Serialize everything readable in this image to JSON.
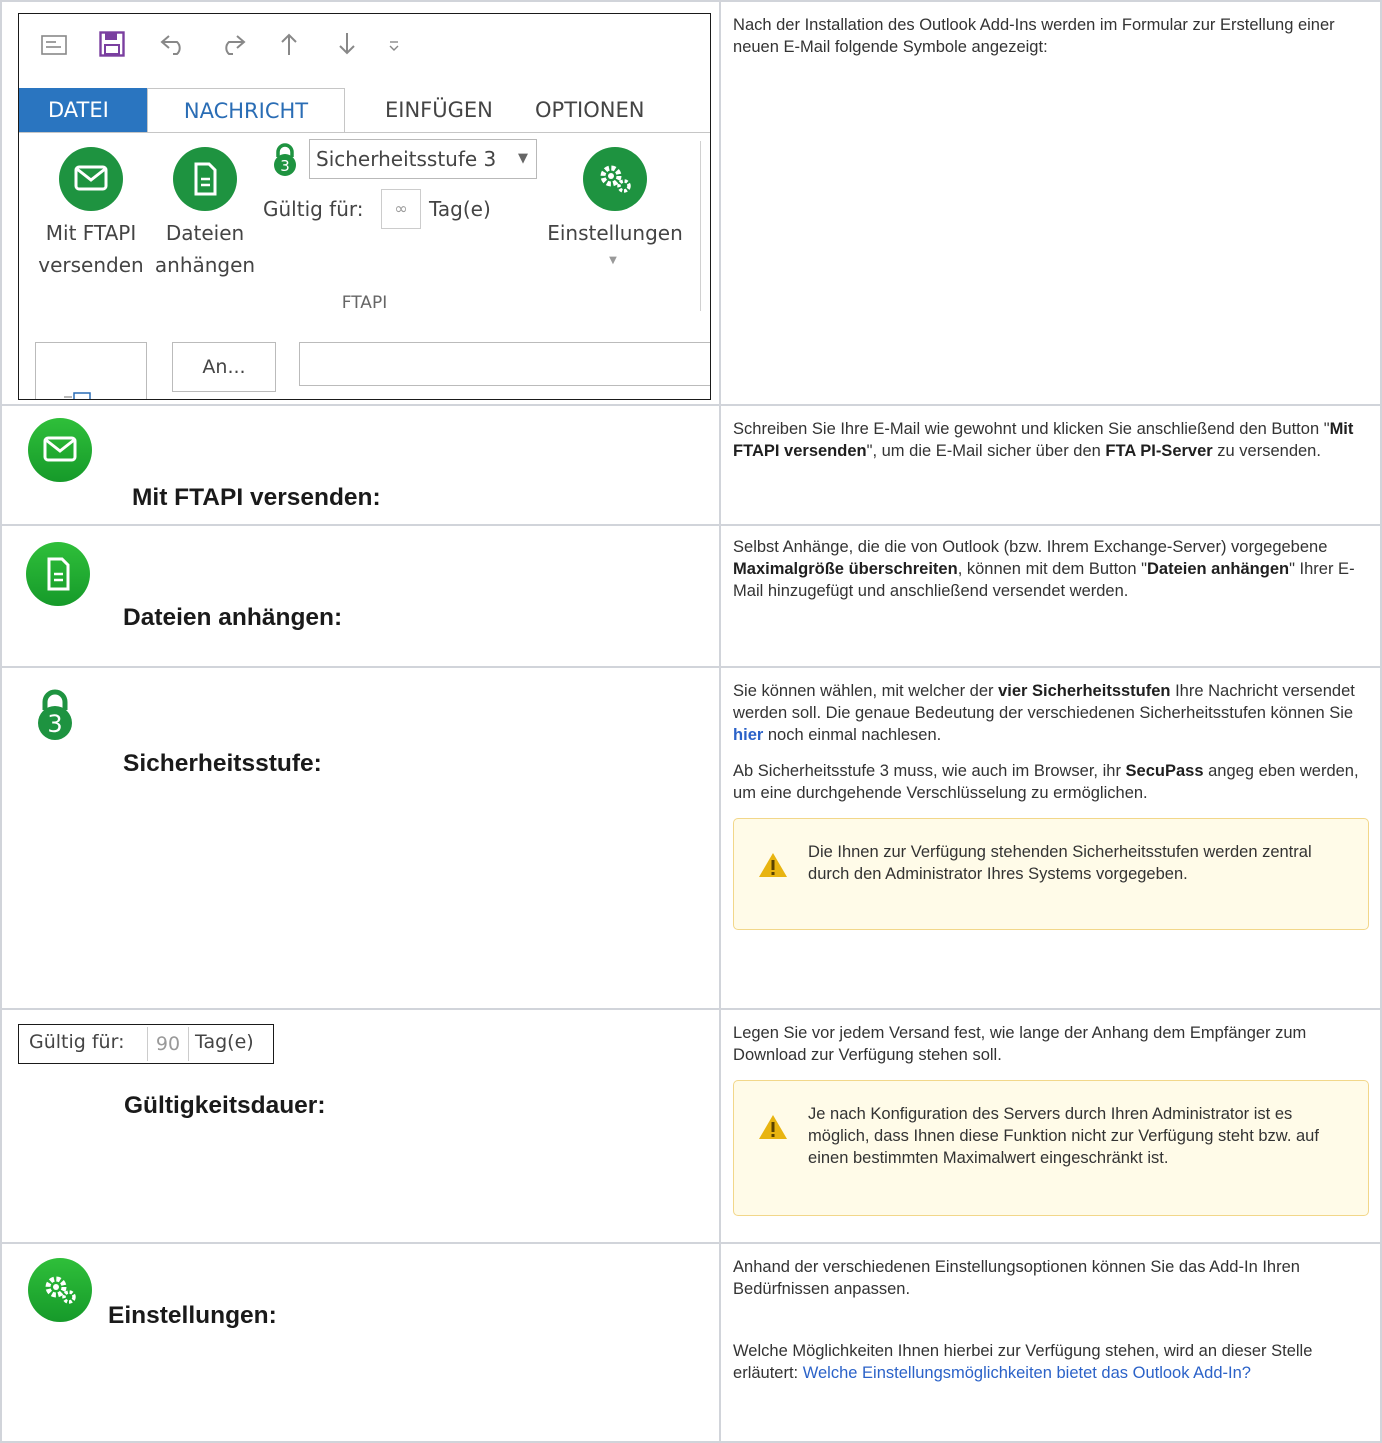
{
  "intro": {
    "text": "Nach der Installation des Outlook Add-Ins werden im Formular zur Erstellung einer neuen E-Mail folgende Symbole angezeigt:"
  },
  "ribbon": {
    "tabs": [
      "DATEI",
      "NACHRICHT",
      "EINFÜGEN",
      "OPTIONEN"
    ],
    "buttons": {
      "send_line1": "Mit FTAPI",
      "send_line2": "versenden",
      "attach_line1": "Dateien",
      "attach_line2": "anhängen",
      "settings": "Einstellungen"
    },
    "security_select": "Sicherheitsstufe 3",
    "security_badge": "3",
    "valid_label": "Gültig für:",
    "valid_value": "∞",
    "valid_unit": "Tag(e)",
    "group_label": "FTAPI",
    "to_button": "An..."
  },
  "rows": {
    "send": {
      "caption": "Mit FTAPI versenden:",
      "t1": "Schreiben Sie Ihre E-Mail wie gewohnt und klicken Sie anschließend den Button \"",
      "b1": "Mit FTAPI versenden",
      "t2": "\", um die E-Mail sicher über den ",
      "b2": "FTA PI-Server",
      "t3": " zu versenden."
    },
    "attach": {
      "caption": "Dateien anhängen:",
      "t1": "Selbst Anhänge, die die von Outlook (bzw. Ihrem Exchange-Server) vorgegebene ",
      "b1": "Maximalgröße überschreiten",
      "t2": ", können mit dem Button \"",
      "b2": "Dateien anhängen",
      "t3": "\" Ihrer E-Mail hinzugefügt und anschließend versendet werden."
    },
    "security": {
      "caption": "Sicherheitsstufe:",
      "badge": "3",
      "p1_t1": "Sie können wählen, mit welcher der ",
      "p1_b1": "vier Sicherheitsstufen",
      "p1_t2": " Ihre Nachricht versendet werden soll. Die genaue Bedeutung der verschiedenen Sicherheitsstufen können Sie ",
      "p1_link": "hier",
      "p1_t3": " noch einmal nachlesen.",
      "p2_t1": "Ab Sicherheitsstufe 3 muss, wie auch im Browser, ihr ",
      "p2_b1": "SecuPass",
      "p2_t2": " angeg eben werden, um eine durchgehende Verschlüsselung zu ermöglichen.",
      "note": "Die Ihnen zur Verfügung stehenden Sicherheitsstufen werden zentral durch den Administrator Ihres Systems vorgegeben."
    },
    "validity": {
      "caption": "Gültigkeitsdauer:",
      "field_label": "Gültig für:",
      "field_value": "90",
      "field_unit": "Tag(e)",
      "text": "Legen Sie vor jedem Versand fest, wie lange der Anhang dem Empfänger zum Download zur Verfügung stehen soll.",
      "note": "Je nach Konfiguration des Servers durch Ihren Administrator ist es möglich, dass Ihnen diese Funktion nicht zur Verfügung steht bzw. auf einen bestimmten Maximalwert eingeschränkt ist."
    },
    "settings": {
      "caption": "Einstellungen:",
      "p1": "Anhand der verschiedenen Einstellungsoptionen können Sie das Add-In Ihren Bedürfnissen anpassen.",
      "p2": "Welche Möglichkeiten Ihnen hierbei zur Verfügung stehen, wird an dieser Stelle erläutert: ",
      "link": "Welche Einstellungsmöglichkeiten bietet das Outlook Add-In?"
    }
  },
  "colors": {
    "green": "#1e9340",
    "blue_tab": "#2a75c0",
    "link": "#2b62c8",
    "note_bg": "#fffbe8",
    "warn": "#e8b410"
  }
}
